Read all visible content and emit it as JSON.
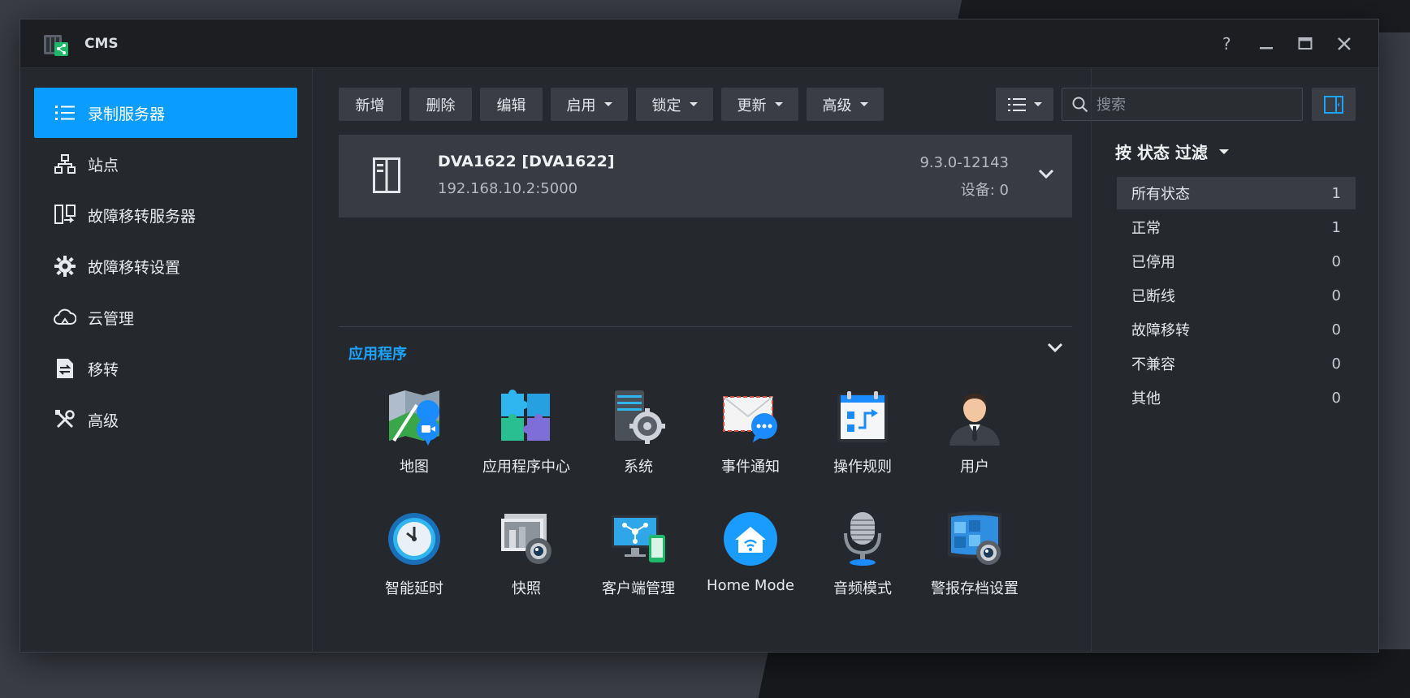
{
  "window": {
    "title": "CMS"
  },
  "sidebar": {
    "items": [
      {
        "label": "录制服务器",
        "icon": "list-icon",
        "active": true
      },
      {
        "label": "站点",
        "icon": "sitemap-icon"
      },
      {
        "label": "故障移转服务器",
        "icon": "failover-server-icon"
      },
      {
        "label": "故障移转设置",
        "icon": "gear-icon"
      },
      {
        "label": "云管理",
        "icon": "cloud-icon"
      },
      {
        "label": "移转",
        "icon": "migrate-icon"
      },
      {
        "label": "高级",
        "icon": "tools-icon"
      }
    ]
  },
  "toolbar": {
    "add": "新增",
    "delete": "删除",
    "edit": "编辑",
    "enable": "启用",
    "lock": "锁定",
    "update": "更新",
    "advanced": "高级",
    "search_placeholder": "搜索"
  },
  "server": {
    "name": "DVA1622 [DVA1622]",
    "address": "192.168.10.2:5000",
    "version": "9.3.0-12143",
    "devices": "设备: 0"
  },
  "apps": {
    "title": "应用程序",
    "items": [
      {
        "label": "地图",
        "icon": "map-icon"
      },
      {
        "label": "应用程序中心",
        "icon": "puzzle-icon"
      },
      {
        "label": "系统",
        "icon": "system-icon"
      },
      {
        "label": "事件通知",
        "icon": "notification-icon"
      },
      {
        "label": "操作规则",
        "icon": "action-rule-icon"
      },
      {
        "label": "用户",
        "icon": "user-icon"
      },
      {
        "label": "智能延时",
        "icon": "time-lapse-icon"
      },
      {
        "label": "快照",
        "icon": "snapshot-icon"
      },
      {
        "label": "客户端管理",
        "icon": "client-management-icon"
      },
      {
        "label": "Home Mode",
        "icon": "home-mode-icon"
      },
      {
        "label": "音频模式",
        "icon": "microphone-icon"
      },
      {
        "label": "警报存档设置",
        "icon": "alert-archive-icon"
      }
    ]
  },
  "filter": {
    "title": "按 状态 过滤",
    "items": [
      {
        "label": "所有状态",
        "count": "1",
        "active": true
      },
      {
        "label": "正常",
        "count": "1"
      },
      {
        "label": "已停用",
        "count": "0"
      },
      {
        "label": "已断线",
        "count": "0"
      },
      {
        "label": "故障移转",
        "count": "0"
      },
      {
        "label": "不兼容",
        "count": "0"
      },
      {
        "label": "其他",
        "count": "0"
      }
    ]
  },
  "colors": {
    "accent": "#0a9cff",
    "window_bg": "#25282d",
    "titlebar_bg": "#1c1e22"
  }
}
